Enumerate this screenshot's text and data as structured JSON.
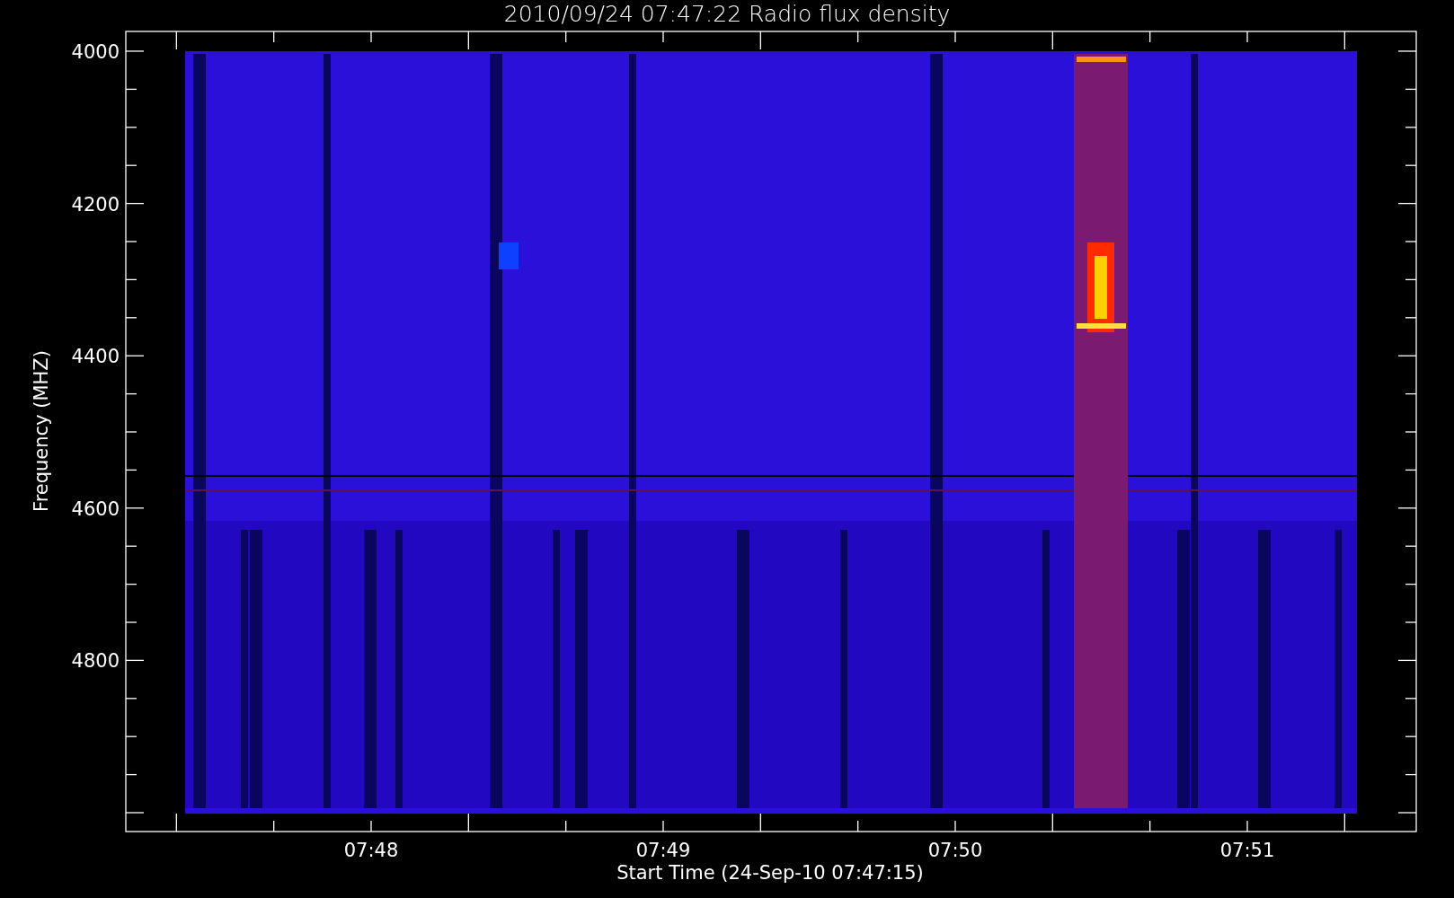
{
  "title": "2010/09/24 07:47:22 Radio flux density",
  "y_axis": {
    "label": "Frequency (MHZ)",
    "ticks": [
      "4000",
      "4200",
      "4400",
      "4600",
      "4800"
    ]
  },
  "x_axis": {
    "label": "Start Time (24-Sep-10 07:47:15)",
    "ticks": [
      "07:48",
      "07:49",
      "07:50",
      "07:51"
    ]
  }
}
